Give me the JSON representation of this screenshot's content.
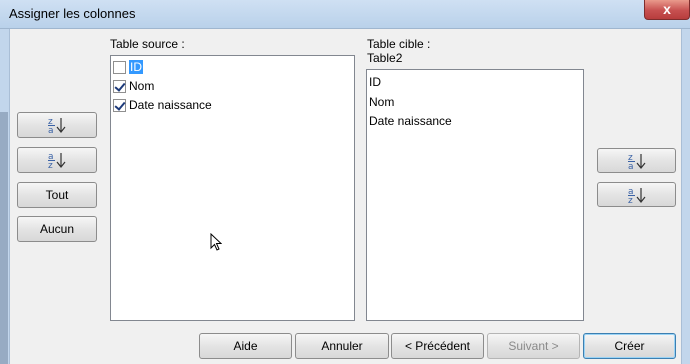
{
  "window": {
    "title": "Assigner les colonnes",
    "close_glyph": "x"
  },
  "source": {
    "label": "Table source :",
    "items": [
      {
        "label": "ID",
        "checked": false,
        "selected": true
      },
      {
        "label": "Nom",
        "checked": true,
        "selected": false
      },
      {
        "label": "Date naissance",
        "checked": true,
        "selected": false
      }
    ]
  },
  "target": {
    "label": "Table cible :",
    "table_name": "Table2",
    "items": [
      "ID",
      "Nom",
      "Date naissance"
    ]
  },
  "left_buttons": {
    "all_label": "Tout",
    "none_label": "Aucun"
  },
  "footer": {
    "help": "Aide",
    "cancel": "Annuler",
    "prev": "< Précédent",
    "next": "Suivant >",
    "create": "Créer"
  },
  "colors": {
    "selection": "#3399ff",
    "title_bar": "#b9d1ea",
    "close": "#c75050"
  },
  "icons": [
    "sort-descending-icon",
    "sort-ascending-icon",
    "close-icon",
    "mouse-cursor-icon"
  ]
}
